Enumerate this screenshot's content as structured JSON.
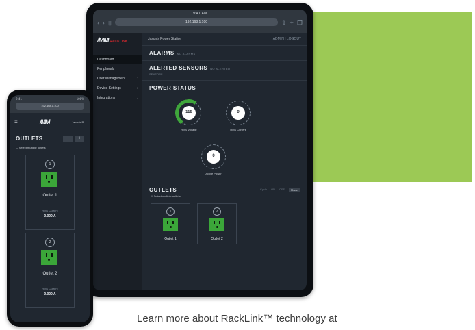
{
  "colors": {
    "green_block": "#9cc955",
    "outlet_on": "#3ba639",
    "panel_bg": "#202730",
    "gauge_arc": "#3fa63b"
  },
  "tablet": {
    "status_time": "9:41 AM",
    "url": "192.168.1.100",
    "logo": "/MM",
    "logo_sub": "RACKLINK",
    "nav": [
      {
        "label": "Dashboard",
        "active": true
      },
      {
        "label": "Peripherals"
      },
      {
        "label": "User Management",
        "arrow": "›"
      },
      {
        "label": "Device Settings",
        "arrow": "›"
      },
      {
        "label": "Integrations",
        "arrow": "›"
      }
    ],
    "header_title": "Jason's Power Station",
    "header_right": "ADMIN   |   LOGOUT",
    "alarms": {
      "title": "ALARMS",
      "note": "NO ALARMS"
    },
    "alerted": {
      "title": "ALERTED SENSORS",
      "note": "NO ALERTED",
      "sub": "SENSORS"
    },
    "power_status": {
      "title": "POWER STATUS",
      "gauges": [
        {
          "value": "119",
          "unit": "volts",
          "label": "RMS Voltage",
          "min": "100",
          "max": "140"
        },
        {
          "value": "0",
          "unit": "amps",
          "label": "RMS Current",
          "min": "0",
          "max": "15"
        },
        {
          "value": "0",
          "unit": "watts",
          "label": "Active Power",
          "min": "0",
          "max": "1800"
        }
      ]
    },
    "outlets": {
      "title": "OUTLETS",
      "actions": [
        "Cycle",
        "ON",
        "OFF",
        "Mode"
      ],
      "select_multiple": "Select multiple outlets",
      "cards": [
        {
          "num": "1",
          "name": "Outlet 1"
        },
        {
          "num": "2",
          "name": "Outlet 2"
        }
      ]
    }
  },
  "phone": {
    "status_left": "9:41",
    "status_right": "100%",
    "url": "192.168.1.100",
    "logo": "/MM",
    "user": "Jason's P...",
    "outlets_title": "OUTLETS",
    "btn_minus": "—",
    "btn_info": "i",
    "select_multiple": "Select multiple outlets",
    "cards": [
      {
        "num": "1",
        "name": "Outlet 1",
        "metric_label": "RMS Current",
        "metric_value": "0.000 A"
      },
      {
        "num": "2",
        "name": "Outlet 2",
        "metric_label": "RMS Current",
        "metric_value": "0.000 A"
      }
    ]
  },
  "caption": "Learn more about RackLink™ technology at"
}
